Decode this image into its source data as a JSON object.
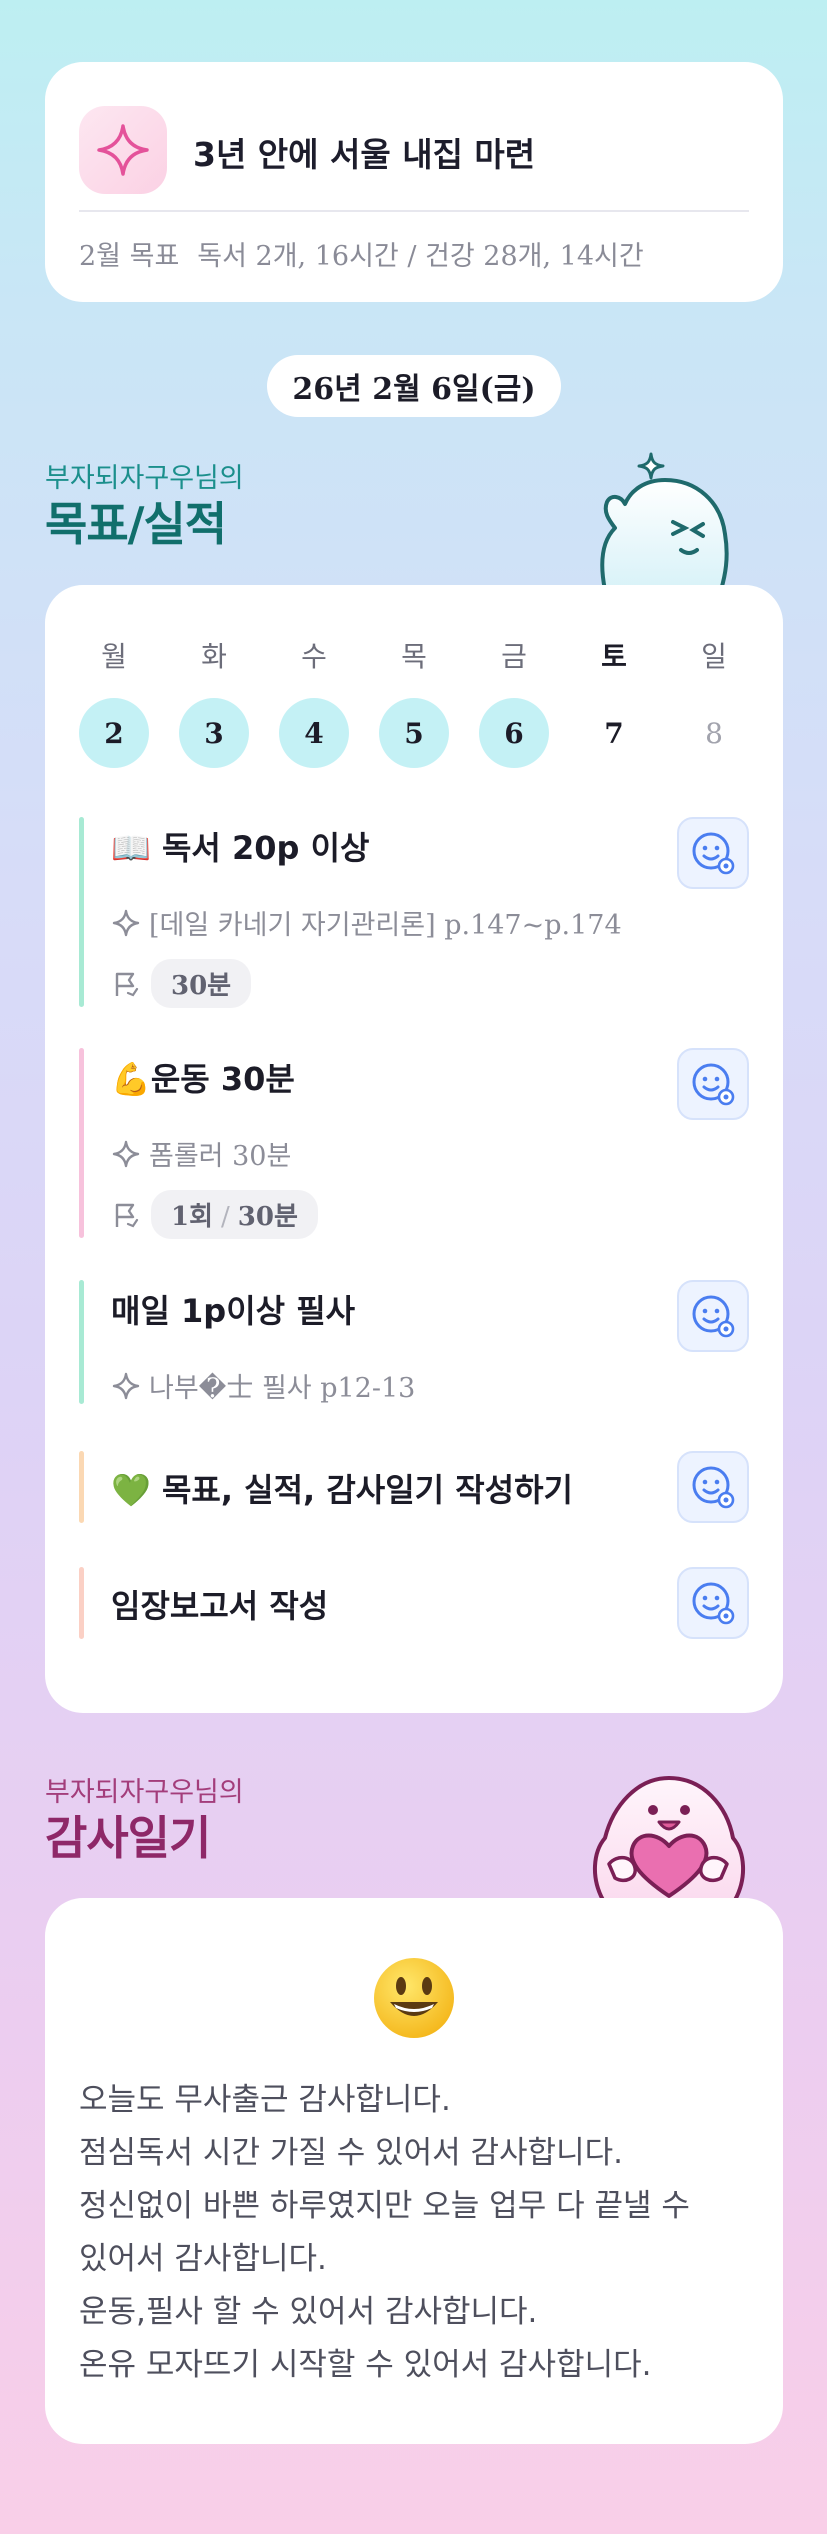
{
  "goal": {
    "title": "3년 안에 서울 내집 마련",
    "month_label": "2월 목표",
    "summary": "독서 2개, 16시간 / 건강 28개, 14시간"
  },
  "date": "26년 2월 6일(금)",
  "goals_section": {
    "subtitle": "부자되자구우님의",
    "title": "목표/실적"
  },
  "week": {
    "weekdays": [
      "월",
      "화",
      "수",
      "목",
      "금",
      "토",
      "일"
    ],
    "days": [
      "2",
      "3",
      "4",
      "5",
      "6",
      "7",
      "8"
    ]
  },
  "tasks": [
    {
      "title": "📖 독서 20p  이상",
      "sub": "[데일 카네기 자기관리론] p.147~p.174",
      "duration": "30분",
      "bar_color": "#a8ead4"
    },
    {
      "title": "💪운동 30분",
      "sub": "폼롤러 30분",
      "count": "1회",
      "duration": "30분",
      "bar_color": "#f7c2dc"
    },
    {
      "title": "매일 1p이상 필사",
      "sub": "나부�士 필사 p12-13",
      "bar_color": "#a8ead4"
    },
    {
      "title": "💚 목표, 실적, 감사일기 작성하기",
      "bar_color": "#fbd8b3"
    },
    {
      "title": "임장보고서 작성",
      "bar_color": "#fbd0c5"
    }
  ],
  "thanks_section": {
    "subtitle": "부자되자구우님의",
    "title": "감사일기"
  },
  "thanks": {
    "emoji": "😃",
    "lines": [
      "오늘도 무사출근 감사합니다.",
      "점심독서 시간 가질 수 있어서 감사합니다.",
      "정신없이 바쁜 하루였지만 오늘 업무 다 끝낼 수",
      "있어서 감사합니다.",
      "운동,필사 할 수 있어서 감사합니다.",
      "온유 모자뜨기 시작할 수 있어서 감사합니다."
    ]
  },
  "colors": {
    "accent_teal": "#116f6c",
    "accent_pink": "#8e2868",
    "day_fill": "#c4f1f5",
    "face_icon": "#4a7df0"
  },
  "icons": [
    "sparkle-icon",
    "flag-icon",
    "smile-face-icon",
    "mascot-teal",
    "mascot-pink"
  ]
}
